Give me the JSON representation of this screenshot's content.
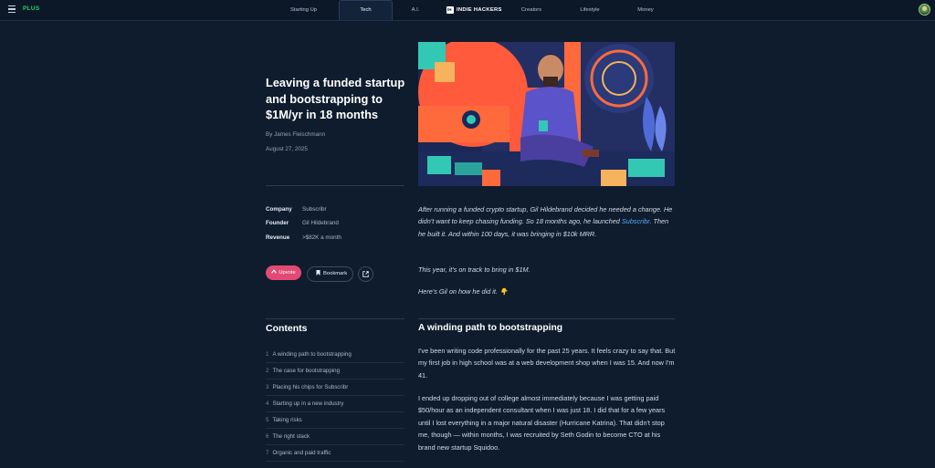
{
  "nav": {
    "plus": "PLUS",
    "tabs": [
      "Starting Up",
      "Tech",
      "A.I.",
      "INDIE HACKERS",
      "Creators",
      "Lifestyle",
      "Money"
    ]
  },
  "article": {
    "title": "Leaving a funded startup and bootstrapping to $1M/yr in 18 months",
    "byline": "By James Fleischmann",
    "date": "August 27, 2025",
    "facts": [
      {
        "label": "Company",
        "value": "Subscribr"
      },
      {
        "label": "Founder",
        "value": "Gil Hildebrand"
      },
      {
        "label": "Revenue",
        "value": ">$82K a month"
      }
    ],
    "upvote_label": "Upvote",
    "bookmark_label": "Bookmark",
    "intro_p1_before": "After running a funded crypto startup, Gil Hildebrand decided he needed a change. He didn't want to keep chasing funding. So 18 months ago, he launched ",
    "intro_link": "Subscribr",
    "intro_p1_after": ". Then he built it. And within 100 days, it was bringing in $10k MRR.",
    "intro_p2": "This year, it's on track to bring in $1M.",
    "intro_p3": "Here's Gil on how he did it. 👇",
    "section_title": "A winding path to bootstrapping",
    "body_p1": "I've been writing code professionally for the past 25 years. It feels crazy to say that. But my first job in high school was at a web development shop when I was 15. And now I'm 41.",
    "body_p2": "I ended up dropping out of college almost immediately because I was getting paid $50/hour as an independent consultant when I was just 18. I did that for a few years until I lost everything in a major natural disaster (Hurricane Katrina). That didn't stop me, though — within months, I was recruited by Seth Godin to become CTO at his brand new startup Squidoo."
  },
  "contents": {
    "title": "Contents",
    "items": [
      {
        "num": "1",
        "label": "A winding path to bootstrapping"
      },
      {
        "num": "2",
        "label": "The case for bootstrapping"
      },
      {
        "num": "3",
        "label": "Placing his chips for Subscribr"
      },
      {
        "num": "4",
        "label": "Starting up in a new industry"
      },
      {
        "num": "5",
        "label": "Taking risks"
      },
      {
        "num": "6",
        "label": "The right stack"
      },
      {
        "num": "7",
        "label": "Organic and paid traffic"
      }
    ]
  },
  "colors": {
    "background": "#0f1c2e",
    "accent_green": "#29d36a",
    "upvote": "#e24a73",
    "link": "#5aa7ff"
  }
}
